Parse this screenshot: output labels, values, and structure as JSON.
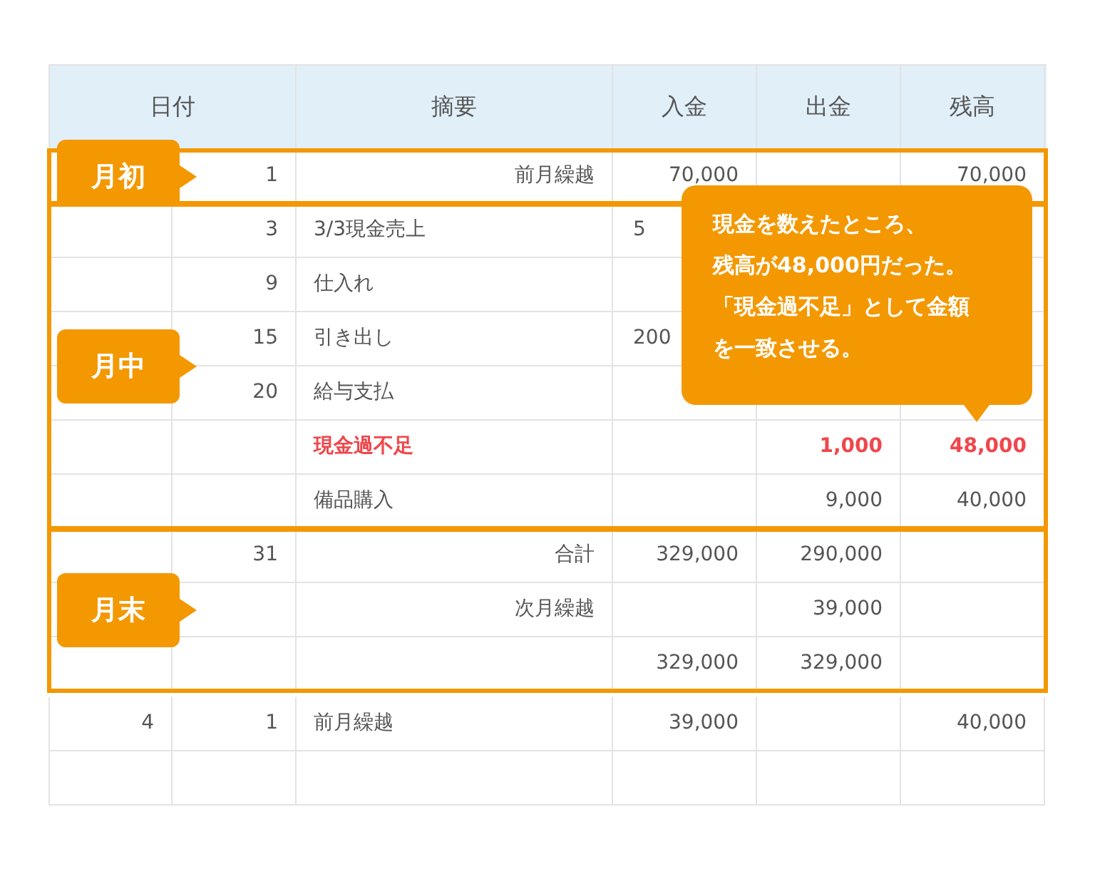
{
  "table": {
    "columns": [
      "日付",
      "摘要",
      "入金",
      "出金",
      "残高"
    ],
    "groups": [
      {
        "tag": "月初",
        "outlined": true,
        "rows": [
          {
            "kind": "carry",
            "highlight": false,
            "cells": [
              "",
              "1",
              "前月繰越",
              "70,000",
              "",
              "70,000"
            ]
          }
        ]
      },
      {
        "tag": "月中",
        "outlined": true,
        "rows": [
          {
            "kind": "entry",
            "covered": true,
            "highlight": false,
            "cells": [
              "",
              "3",
              "3/3現金売上",
              "5",
              "",
              ""
            ]
          },
          {
            "kind": "entry",
            "highlight": false,
            "cells": [
              "",
              "9",
              "仕入れ",
              "",
              "",
              ""
            ]
          },
          {
            "kind": "entry",
            "covered": true,
            "highlight": false,
            "cells": [
              "",
              "15",
              "引き出し",
              "200",
              "",
              ""
            ]
          },
          {
            "kind": "entry",
            "highlight": false,
            "cells": [
              "",
              "20",
              "給与支払",
              "",
              "",
              ""
            ]
          },
          {
            "kind": "entry",
            "highlight": true,
            "cells": [
              "",
              "",
              "現金過不足",
              "",
              "1,000",
              "48,000"
            ]
          },
          {
            "kind": "entry",
            "highlight": false,
            "cells": [
              "",
              "",
              "備品購入",
              "",
              "9,000",
              "40,000"
            ]
          }
        ]
      },
      {
        "tag": "月末",
        "outlined": true,
        "rows": [
          {
            "kind": "carry",
            "highlight": false,
            "cells": [
              "",
              "31",
              "合計",
              "329,000",
              "290,000",
              ""
            ]
          },
          {
            "kind": "carry",
            "highlight": false,
            "cells": [
              "",
              "",
              "次月繰越",
              "",
              "39,000",
              ""
            ]
          },
          {
            "kind": "carry",
            "cells": [
              "",
              "",
              "",
              "329,000",
              "329,000",
              ""
            ]
          }
        ]
      },
      {
        "outlined": false,
        "rows": [
          {
            "kind": "entry",
            "highlight": false,
            "cells": [
              "4",
              "1",
              "前月繰越",
              "39,000",
              "",
              "40,000"
            ]
          },
          {
            "kind": "entry",
            "cells": [
              "",
              "",
              "",
              "",
              "",
              ""
            ]
          }
        ]
      }
    ]
  },
  "callout": {
    "lines": [
      "現金を数えたところ、",
      "残高が48,000円だった。",
      "「現金過不足」として金額",
      "を一致させる。"
    ]
  }
}
